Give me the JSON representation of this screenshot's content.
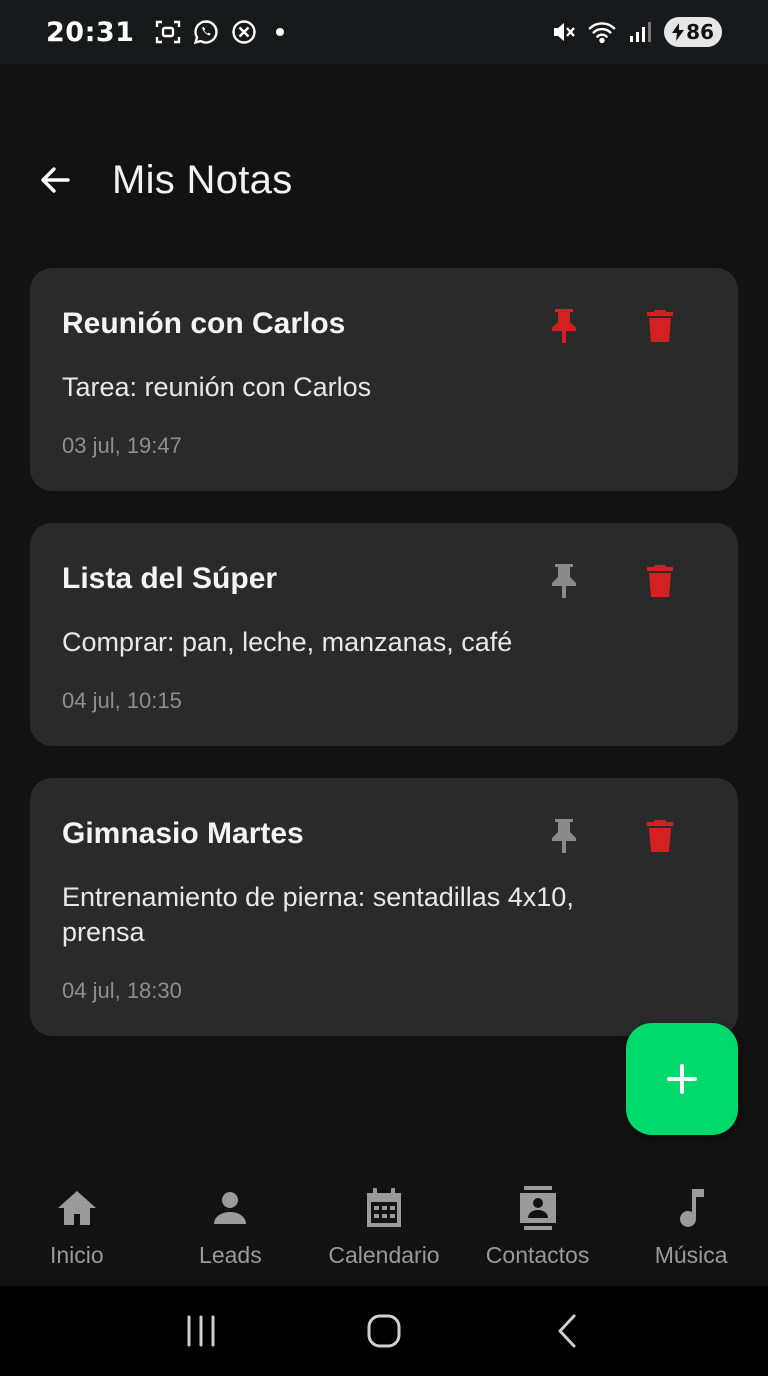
{
  "status_bar": {
    "time": "20:31",
    "battery": "86",
    "icons": [
      "screenshot-icon",
      "whatsapp-icon",
      "close-circle-icon",
      "mute-icon",
      "wifi-icon",
      "signal-icon",
      "battery-icon"
    ]
  },
  "header": {
    "title": "Mis Notas",
    "back_icon": "arrow-left-icon"
  },
  "notes": [
    {
      "title": "Reunión con Carlos",
      "body": "Tarea: reunión con Carlos",
      "date": "03 jul, 19:47",
      "pinned": true
    },
    {
      "title": "Lista del Súper",
      "body": "Comprar: pan, leche, manzanas, café",
      "date": "04 jul, 10:15",
      "pinned": false
    },
    {
      "title": "Gimnasio Martes",
      "body": "Entrenamiento de pierna: sentadillas 4x10, prensa",
      "date": "04 jul, 18:30",
      "pinned": false
    }
  ],
  "fab": {
    "icon": "plus-icon"
  },
  "bottom_nav": {
    "items": [
      {
        "label": "Inicio",
        "icon": "home-icon"
      },
      {
        "label": "Leads",
        "icon": "person-icon"
      },
      {
        "label": "Calendario",
        "icon": "calendar-icon"
      },
      {
        "label": "Contactos",
        "icon": "contacts-icon"
      },
      {
        "label": "Música",
        "icon": "music-note-icon"
      }
    ]
  },
  "colors": {
    "background": "#121212",
    "card": "#2a2a2a",
    "pinned": "#d32020",
    "unpinned": "#8a8a8a",
    "delete": "#d32020",
    "accent": "#00d96b",
    "nav_label": "#9a9a9a"
  }
}
